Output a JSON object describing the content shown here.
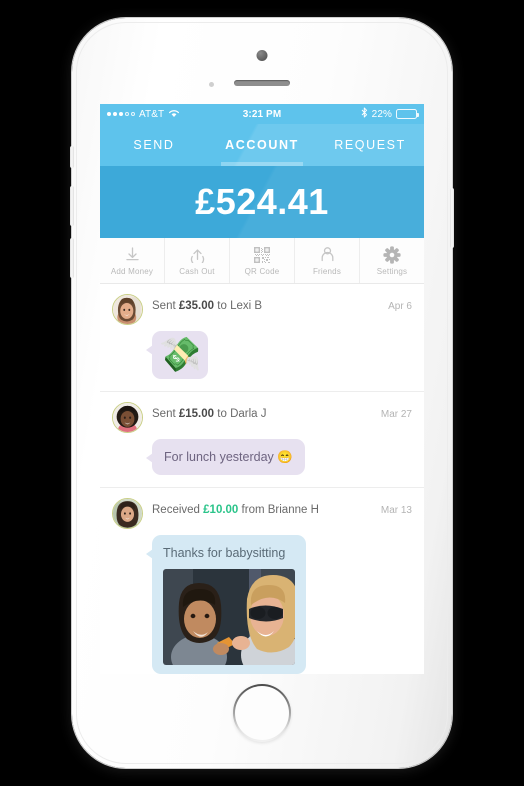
{
  "device": {
    "name": "white-smartphone",
    "hardware": {
      "earpiece": "earpiece-speaker",
      "camera": "front-camera",
      "proximity": "proximity-sensor",
      "home": "home-button",
      "power": "power-button",
      "volume_up": "volume-up-button",
      "volume_down": "volume-down-button",
      "silent": "silent-switch"
    }
  },
  "status_bar": {
    "signal_dots_filled": 3,
    "signal_dots_hollow": 2,
    "carrier": "AT&T",
    "wifi_icon": "wifi-icon",
    "time": "3:21 PM",
    "bluetooth_icon": "bluetooth-icon",
    "battery_percent": "22%",
    "battery_fill_pct": 22
  },
  "tabs": [
    {
      "label": "SEND",
      "active": false
    },
    {
      "label": "ACCOUNT",
      "active": true
    },
    {
      "label": "REQUEST",
      "active": false
    }
  ],
  "balance": {
    "amount": "£524.41"
  },
  "actions": [
    {
      "label": "Add Money",
      "icon": "download-arrow-icon"
    },
    {
      "label": "Cash Out",
      "icon": "upload-arrow-icon"
    },
    {
      "label": "QR Code",
      "icon": "qr-code-icon"
    },
    {
      "label": "Friends",
      "icon": "person-icon"
    },
    {
      "label": "Settings",
      "icon": "gear-icon"
    }
  ],
  "transactions": [
    {
      "verb": "Sent",
      "amount": "£35.00",
      "amount_positive": false,
      "preposition": "to",
      "counterparty": "Lexi B",
      "date": "Apr 6",
      "avatar": "avatar-lexi-b",
      "bubble": {
        "style": "lavender",
        "emoji": "💸",
        "text": "",
        "photo": false
      }
    },
    {
      "verb": "Sent",
      "amount": "£15.00",
      "amount_positive": false,
      "preposition": "to",
      "counterparty": "Darla J",
      "date": "Mar 27",
      "avatar": "avatar-darla-j",
      "bubble": {
        "style": "lavender",
        "emoji": "",
        "text": "For lunch yesterday 😁",
        "photo": false
      }
    },
    {
      "verb": "Received",
      "amount": "£10.00",
      "amount_positive": true,
      "preposition": "from",
      "counterparty": "Brianne H",
      "date": "Mar 13",
      "avatar": "avatar-brianne-h",
      "bubble": {
        "style": "blue",
        "emoji": "",
        "text": "Thanks for babysitting",
        "photo": true,
        "photo_name": "photo-child-and-woman"
      }
    }
  ],
  "colors": {
    "header_light_blue": "#5ec3ec",
    "balance_blue": "#3da9d9",
    "positive_green": "#2bc48a",
    "bubble_lavender": "#e7e1f0",
    "bubble_blue": "#d5e9f4",
    "avatar_ring": "#c9cf86",
    "text_gray": "#6a6a6a",
    "muted_gray": "#b4b4b4"
  }
}
